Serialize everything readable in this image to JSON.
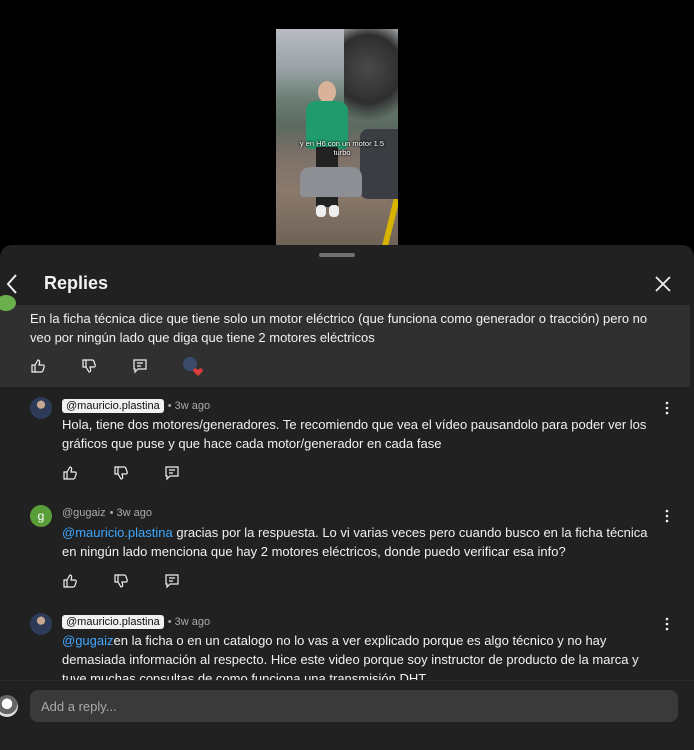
{
  "video": {
    "caption": "y en H6 con un motor 1.5 turbo"
  },
  "header": {
    "title": "Replies",
    "back_icon": "chevron-left-icon",
    "close_icon": "close-icon"
  },
  "parent_comment": {
    "text": "En la ficha técnica dice que tiene solo un motor eléctrico (que funciona como generador o tracción) pero no veo por ningún lado que diga que tiene 2 motores eléctricos"
  },
  "replies": [
    {
      "author": "@mauricio.plastina",
      "is_creator": true,
      "time": "• 3w ago",
      "mention": "",
      "text": "Hola, tiene dos motores/generadores. Te recomiendo que vea el vídeo pausandolo para poder ver los gráficos que puse y que hace cada motor/generador en cada fase"
    },
    {
      "author": "@gugaiz",
      "avatar_letter": "g",
      "is_creator": false,
      "time": "• 3w ago",
      "mention": "@mauricio.plastina",
      "text": " gracias por la respuesta. Lo vi varias veces pero cuando busco en la ficha técnica en ningún lado menciona que hay 2 motores eléctricos, donde puedo verificar esa info?"
    },
    {
      "author": "@mauricio.plastina",
      "is_creator": true,
      "time": "• 3w ago",
      "mention": "@gugaiz",
      "text": "en la ficha o en un catalogo no lo vas a ver explicado porque es algo técnico y no hay demasiada información al respecto. Hice este video porque soy instructor de producto de la marca y tuve muchas consultas de como funciona una  transmisión DHT"
    }
  ],
  "composer": {
    "placeholder": "Add a reply..."
  },
  "colors": {
    "sheet_bg": "#212121",
    "highlight_bg": "#303030",
    "mention": "#3ea6ff",
    "text": "#f1f1f1",
    "muted": "#aaaaaa",
    "avatar_g": "#5a9e3a",
    "heart": "#e03c3c"
  }
}
